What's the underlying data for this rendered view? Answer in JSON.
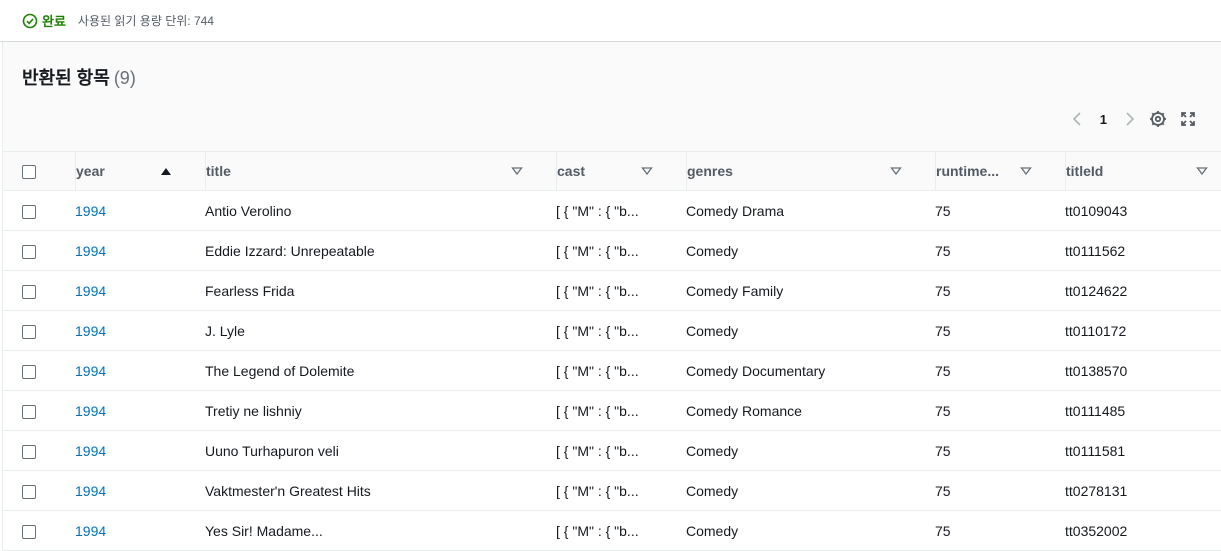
{
  "status": {
    "label": "완료",
    "detail": "사용된 읽기 용량 단위: 744",
    "color": "#1d8102"
  },
  "panel": {
    "title": "반환된 항목",
    "count": "(9)"
  },
  "pager": {
    "prev_icon": "chevron-left-icon",
    "page": "1",
    "next_icon": "chevron-right-icon"
  },
  "tools": {
    "settings_icon": "gear-icon",
    "fullscreen_icon": "expand-icon"
  },
  "table": {
    "columns": [
      "year",
      "title",
      "cast",
      "genres",
      "runtime...",
      "titleId"
    ],
    "rows": [
      {
        "year": "1994",
        "title": "Antio Verolino",
        "cast": "[ { \"M\" : { \"b...",
        "genres": "Comedy Drama",
        "runtime": "75",
        "titleId": "tt0109043"
      },
      {
        "year": "1994",
        "title": "Eddie Izzard: Unrepeatable",
        "cast": "[ { \"M\" : { \"b...",
        "genres": "Comedy",
        "runtime": "75",
        "titleId": "tt0111562"
      },
      {
        "year": "1994",
        "title": "Fearless Frida",
        "cast": "[ { \"M\" : { \"b...",
        "genres": "Comedy Family",
        "runtime": "75",
        "titleId": "tt0124622"
      },
      {
        "year": "1994",
        "title": "J. Lyle",
        "cast": "[ { \"M\" : { \"b...",
        "genres": "Comedy",
        "runtime": "75",
        "titleId": "tt0110172"
      },
      {
        "year": "1994",
        "title": "The Legend of Dolemite",
        "cast": "[ { \"M\" : { \"b...",
        "genres": "Comedy Documentary",
        "runtime": "75",
        "titleId": "tt0138570"
      },
      {
        "year": "1994",
        "title": "Tretiy ne lishniy",
        "cast": "[ { \"M\" : { \"b...",
        "genres": "Comedy Romance",
        "runtime": "75",
        "titleId": "tt0111485"
      },
      {
        "year": "1994",
        "title": "Uuno Turhapuron veli",
        "cast": "[ { \"M\" : { \"b...",
        "genres": "Comedy",
        "runtime": "75",
        "titleId": "tt0111581"
      },
      {
        "year": "1994",
        "title": "Vaktmester'n Greatest Hits",
        "cast": "[ { \"M\" : { \"b...",
        "genres": "Comedy",
        "runtime": "75",
        "titleId": "tt0278131"
      },
      {
        "year": "1994",
        "title": "Yes Sir! Madame...",
        "cast": "[ { \"M\" : { \"b...",
        "genres": "Comedy",
        "runtime": "75",
        "titleId": "tt0352002"
      }
    ]
  }
}
